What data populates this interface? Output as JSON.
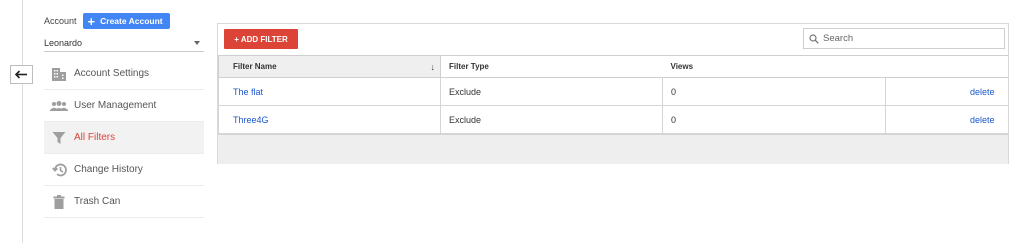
{
  "sidebar": {
    "account_label": "Account",
    "create_account_label": "Create Account",
    "account_selected": "Leonardo",
    "items": [
      {
        "label": "Account Settings",
        "icon": "building-icon",
        "active": false
      },
      {
        "label": "User Management",
        "icon": "people-icon",
        "active": false
      },
      {
        "label": "All Filters",
        "icon": "filter-icon",
        "active": true
      },
      {
        "label": "Change History",
        "icon": "history-icon",
        "active": false
      },
      {
        "label": "Trash Can",
        "icon": "trash-icon",
        "active": false
      }
    ]
  },
  "toolbar": {
    "add_filter_label": "+ ADD FILTER",
    "search_placeholder": "Search"
  },
  "table": {
    "columns": [
      "Filter Name",
      "Filter Type",
      "Views",
      ""
    ],
    "sort_indicator": "↓",
    "rows": [
      {
        "name": "The flat",
        "type": "Exclude",
        "views": "0",
        "action": "delete"
      },
      {
        "name": "Three4G",
        "type": "Exclude",
        "views": "0",
        "action": "delete"
      }
    ]
  },
  "colors": {
    "accent_red": "#db4437",
    "primary_blue": "#4285f4",
    "link_blue": "#1a57c9"
  }
}
